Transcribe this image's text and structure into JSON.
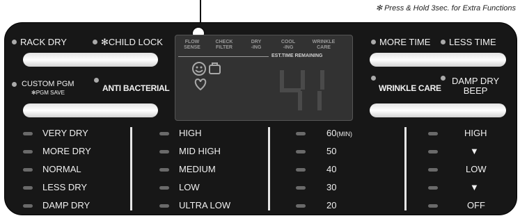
{
  "header": {
    "note": "✻ Press & Hold 3sec. for Extra Functions"
  },
  "top_left": {
    "rack_dry": "RACK DRY",
    "child_lock": "✻CHILD LOCK",
    "custom_pgm": "CUSTOM PGM",
    "pgm_save": "✻PGM SAVE",
    "anti_bacterial": "ANTI BACTERIAL"
  },
  "display": {
    "buttons": [
      {
        "line1": "FLOW",
        "line2": "SENSE"
      },
      {
        "line1": "CHECK",
        "line2": "FILTER"
      },
      {
        "line1": "DRY",
        "line2": "-ING"
      },
      {
        "line1": "COOL",
        "line2": "-ING"
      },
      {
        "line1": "WRINKLE",
        "line2": "CARE"
      }
    ],
    "est_label": "EST.TIME REMAINING",
    "digits": "41"
  },
  "top_right": {
    "more_time": "MORE TIME",
    "less_time": "LESS TIME",
    "wrinkle_care": "WRINKLE CARE",
    "damp_dry_line1": "DAMP DRY",
    "damp_dry_line2": "BEEP"
  },
  "dry_levels": [
    "VERY DRY",
    "MORE DRY",
    "NORMAL",
    "LESS DRY",
    "DAMP DRY"
  ],
  "temps": [
    "HIGH",
    "MID HIGH",
    "MEDIUM",
    "LOW",
    "ULTRA LOW"
  ],
  "times": [
    "60",
    "50",
    "40",
    "30",
    "20"
  ],
  "time_unit": "(MIN)",
  "volume": [
    "HIGH",
    "▼",
    "LOW",
    "▼",
    "OFF"
  ]
}
